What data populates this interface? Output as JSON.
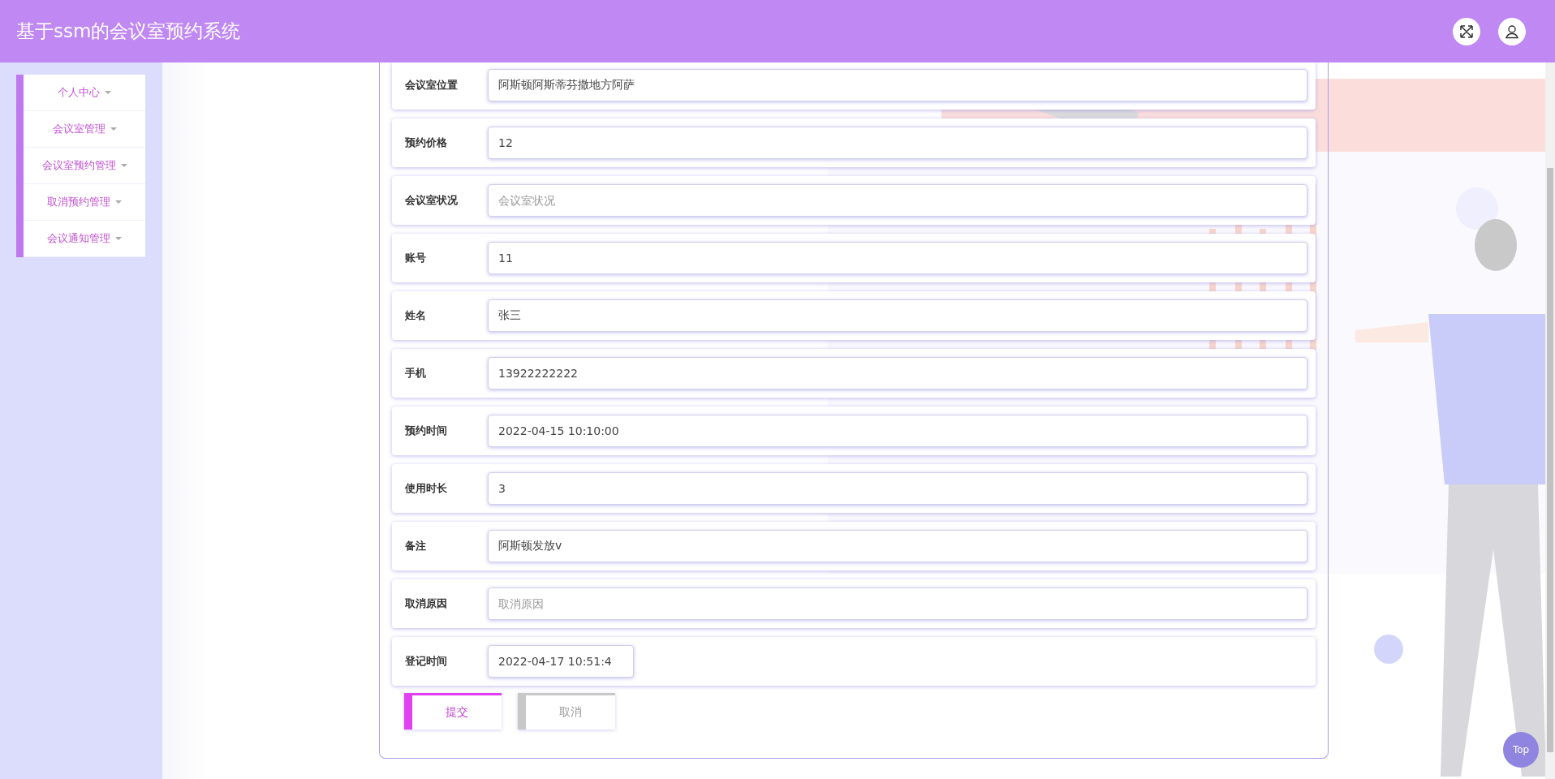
{
  "header": {
    "title": "基于ssm的会议室预约系统"
  },
  "sidebar": {
    "items": [
      {
        "label": "个人中心"
      },
      {
        "label": "会议室管理"
      },
      {
        "label": "会议室预约管理"
      },
      {
        "label": "取消预约管理"
      },
      {
        "label": "会议通知管理"
      }
    ]
  },
  "form": {
    "fields": [
      {
        "label": "会议室位置",
        "kind": "text",
        "value": "阿斯顿阿斯蒂芬撒地方阿萨"
      },
      {
        "label": "预约价格",
        "kind": "text",
        "value": "12"
      },
      {
        "label": "会议室状况",
        "kind": "text",
        "placeholder": "会议室状况"
      },
      {
        "label": "账号",
        "kind": "text",
        "value": "11"
      },
      {
        "label": "姓名",
        "kind": "text",
        "value": "张三"
      },
      {
        "label": "手机",
        "kind": "text",
        "value": "13922222222"
      },
      {
        "label": "预约时间",
        "kind": "text",
        "value": "2022-04-15 10:10:00"
      },
      {
        "label": "使用时长",
        "kind": "text",
        "value": "3"
      },
      {
        "label": "备注",
        "kind": "text",
        "value": "阿斯顿发放v"
      },
      {
        "label": "取消原因",
        "kind": "text",
        "placeholder": "取消原因"
      },
      {
        "label": "登记时间",
        "kind": "datetime",
        "value": "2022-04-17 10:51:4"
      }
    ],
    "buttons": [
      {
        "label": "提交",
        "kind": "primary"
      },
      {
        "label": "取消",
        "kind": "default"
      }
    ]
  },
  "top_button": {
    "label": "Top"
  }
}
